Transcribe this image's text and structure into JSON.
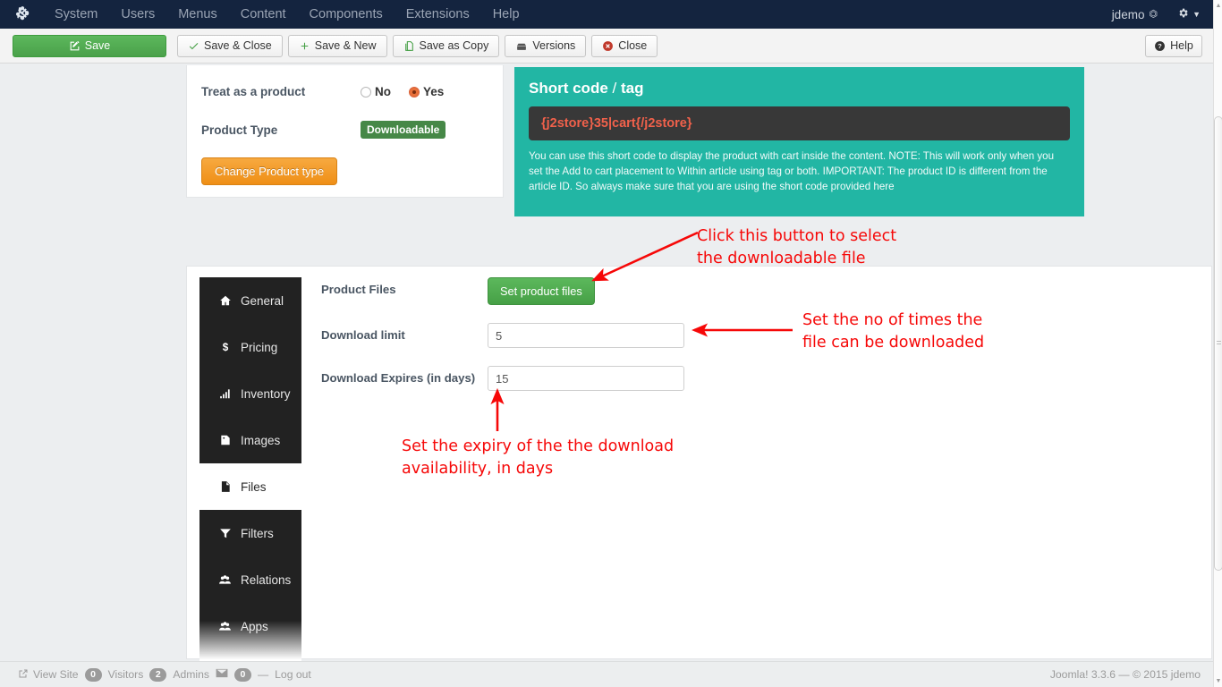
{
  "admin_bar": {
    "logo_icon": "joomla-logo-icon",
    "menu": [
      {
        "label": "System"
      },
      {
        "label": "Users"
      },
      {
        "label": "Menus"
      },
      {
        "label": "Content"
      },
      {
        "label": "Components"
      },
      {
        "label": "Extensions"
      },
      {
        "label": "Help"
      }
    ],
    "user": "jdemo",
    "background_color": "#14243f"
  },
  "toolbar": {
    "save_label": "Save",
    "save_close_label": "Save & Close",
    "save_new_label": "Save & New",
    "save_copy_label": "Save as Copy",
    "versions_label": "Versions",
    "close_label": "Close",
    "help_label": "Help",
    "save_button_color": "#5cb85c"
  },
  "product_meta": {
    "treat_label": "Treat as a product",
    "treat_options": [
      {
        "label": "No",
        "selected": false
      },
      {
        "label": "Yes",
        "selected": true
      }
    ],
    "product_type_label": "Product Type",
    "product_type_value": "Downloadable",
    "product_type_badge_color": "#468847",
    "change_type_label": "Change Product type",
    "change_type_color": "#ef8f16"
  },
  "shortcode": {
    "title_main": "Short code",
    "title_sep": " / ",
    "title_sub": "tag",
    "code": "{j2store}35|cart{/j2store}",
    "code_color": "#f1614b",
    "panel_color": "#22b6a4",
    "description": "You can use this short code to display the product with cart inside the content. NOTE: This will work only when you set the Add to cart placement to Within article using tag or both. IMPORTANT: The product ID is different from the article ID. So always make sure that you are using the short code provided here"
  },
  "tabs": [
    {
      "label": "General",
      "icon": "home-icon",
      "active": false
    },
    {
      "label": "Pricing",
      "icon": "dollar-icon",
      "active": false
    },
    {
      "label": "Inventory",
      "icon": "bar-chart-icon",
      "active": false
    },
    {
      "label": "Images",
      "icon": "image-icon",
      "active": false
    },
    {
      "label": "Files",
      "icon": "file-icon",
      "active": true
    },
    {
      "label": "Filters",
      "icon": "funnel-icon",
      "active": false
    },
    {
      "label": "Relations",
      "icon": "group-icon",
      "active": false
    },
    {
      "label": "Apps",
      "icon": "group-icon",
      "active": false
    }
  ],
  "files_form": {
    "product_files_label": "Product Files",
    "set_product_files_label": "Set product files",
    "set_product_files_color": "#5cb85c",
    "download_limit_label": "Download limit",
    "download_limit_value": "5",
    "download_expires_label": "Download Expires (in days)",
    "download_expires_value": "15"
  },
  "annotations": {
    "color": "#f60808",
    "items": [
      {
        "text": "Click this button to select\nthe downloadable file"
      },
      {
        "text": "Set the no of times the\nfile can be downloaded"
      },
      {
        "text": "Set the expiry of the the download\navailability, in days"
      }
    ]
  },
  "status_bar": {
    "view_site": "View Site",
    "visitors_count": "0",
    "visitors_label": "Visitors",
    "admins_count": "2",
    "admins_label": "Admins",
    "messages_count": "0",
    "dash": "—",
    "logout": "Log out",
    "copyright": "Joomla! 3.3.6  —  © 2015 jdemo"
  }
}
